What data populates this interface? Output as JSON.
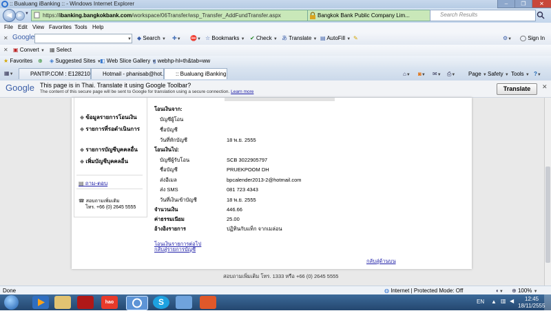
{
  "window": {
    "title": ":: Bualuang iBanking :: - Windows Internet Explorer",
    "controls": [
      "–",
      "❐",
      "✕"
    ]
  },
  "address": {
    "url_pre": "https://",
    "url_host": "ibanking.bangkokbank.com",
    "url_path": "/workspace/06Transfer/wsp_Transfer_AddFundTransfer.aspx",
    "cert": "Bangkok Bank Public Company Lim...",
    "search_placeholder": "Search Results"
  },
  "menu": [
    "File",
    "Edit",
    "View",
    "Favorites",
    "Tools",
    "Help"
  ],
  "google_toolbar": {
    "logo": "Google",
    "search": "Search",
    "bookmarks": "Bookmarks",
    "check": "Check",
    "translate": "Translate",
    "autofill": "AutoFill",
    "signin": "Sign In"
  },
  "convert_bar": {
    "convert": "Convert",
    "select": "Select"
  },
  "favorites_bar": {
    "favorites": "Favorites",
    "items": [
      "Suggested Sites",
      "Web Slice Gallery",
      "webhp-hl=th&tab=ww"
    ]
  },
  "tabs": [
    {
      "label": "PANTIP.COM : E12821096 ..."
    },
    {
      "label": "Hotmail - phanisab@hot..."
    },
    {
      "label": ":: Bualuang iBanking ::"
    }
  ],
  "command_bar": {
    "page": "Page",
    "safety": "Safety",
    "tools": "Tools"
  },
  "translate_bar": {
    "logo": "Google",
    "headline": "This page is in Thai.  Translate it using Google Toolbar?",
    "detail": "The content of this secure page will be sent to Google for translation using a secure connection.",
    "learn_more": "Learn more",
    "button": "Translate"
  },
  "sidebar": {
    "menu_items": [
      "ข้อมูลรายการโอนเงิน",
      "รายการที่รอดำเนินการ",
      "รายการบัญชีบุคคลอื่น",
      "เพิ่มบัญชีบุคคลอื่น"
    ],
    "qa": "ถาม-ตอบ",
    "contact_label": "สอบถามเพิ่มเติม",
    "contact_phone": "โทร. +66 (0) 2645 5555"
  },
  "transfer": {
    "from_heading": "โอนเงินจาก:",
    "from_rows": [
      {
        "label": "บัญชีผู้โอน",
        "value": ""
      },
      {
        "label": "ชื่อบัญชี",
        "value": ""
      },
      {
        "label": "วันที่หักบัญชี",
        "value": "18 พ.ย. 2555"
      }
    ],
    "to_heading": "โอนเงินไป:",
    "to_rows": [
      {
        "label": "บัญชีผู้รับโอน",
        "value": "SCB 3022905797"
      },
      {
        "label": "ชื่อบัญชี",
        "value": "PRUEKPOOM DH"
      },
      {
        "label": "ส่งอีเมล",
        "value": "bpcalender2013-2@hotmail.com"
      },
      {
        "label": "ส่ง SMS",
        "value": "081 723 4343"
      },
      {
        "label": "วันที่เงินเข้าบัญชี",
        "value": "18 พ.ย. 2555"
      }
    ],
    "amount_label": "จำนวนเงิน",
    "amount_value": "446.66",
    "fee_label": "ค่าธรรมเนียม",
    "fee_value": "25.00",
    "ref_label": "อ้างอิงรายการ",
    "ref_value": "ปฏิทินกับแท็ก จากเมล่อน",
    "link1": "โอนเงินรายการต่อไป",
    "link2": "กลับสู่รายการบัญชี",
    "back_link": "กลับสู่ด้านบน"
  },
  "footer": "สอบถามเพิ่มเติม โทร. 1333 หรือ +66 (0) 2645 5555",
  "status_bar": {
    "left": "Done",
    "zone": "Internet | Protected Mode: Off",
    "zoom": "100%"
  },
  "taskbar": {
    "lang": "EN",
    "time": "12:45",
    "date": "18/11/2555",
    "hao_label": "hao 123"
  },
  "colors": {
    "link": "#1a1aa6",
    "ok_green": "#c9e8b9",
    "taskbar": "#2b5582"
  }
}
